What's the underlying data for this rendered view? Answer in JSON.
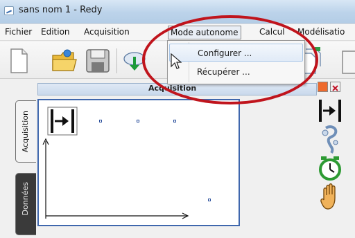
{
  "window": {
    "title": "sans nom 1 - Redy"
  },
  "menubar": {
    "items": [
      "Fichier",
      "Edition",
      "Acquisition",
      "Mode autonome",
      "Calcul",
      "Modélisatio"
    ]
  },
  "dropdown": {
    "items": [
      "Configurer ...",
      "Récupérer ..."
    ]
  },
  "panel": {
    "title": "Acquisition"
  },
  "side_tabs": [
    "Acquisition",
    "Données"
  ],
  "colors": {
    "highlight_ellipse": "#c0141c",
    "canvas_border": "#3f67ad",
    "menu_hover": "#a8c6e8"
  }
}
